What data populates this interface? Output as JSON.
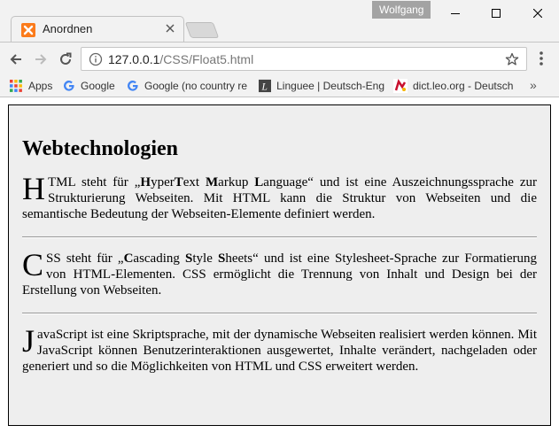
{
  "window": {
    "profile_name": "Wolfgang"
  },
  "tab": {
    "title": "Anordnen"
  },
  "address_bar": {
    "url_host": "127.0.0.1",
    "url_path": "/CSS/Float5.html"
  },
  "bookmarks": [
    {
      "label": "Apps",
      "icon": "apps-grid-icon"
    },
    {
      "label": "Google",
      "icon": "google-icon"
    },
    {
      "label": "Google (no country re",
      "icon": "google-icon"
    },
    {
      "label": "Linguee | Deutsch-Eng",
      "icon": "linguee-icon"
    },
    {
      "label": "dict.leo.org - Deutsch",
      "icon": "leo-icon"
    }
  ],
  "page": {
    "heading": "Webtechnologien",
    "paragraphs": [
      {
        "cap": "H",
        "text_a": "TML steht für „",
        "b1": "H",
        "t1": "yper",
        "b2": "T",
        "t2": "ext ",
        "b3": "M",
        "t3": "arkup ",
        "b4": "L",
        "t4": "anguage",
        "text_b": "“ und ist eine Auszeichnungssprache zur Strukturierung Webseiten. Mit HTML kann die Struktur von Webseiten und die semantische Bedeutung der Webseiten-Elemente definiert werden."
      },
      {
        "cap": "C",
        "text_a": "SS steht für „",
        "b1": "C",
        "t1": "ascading ",
        "b2": "S",
        "t2": "tyle ",
        "b3": "S",
        "t3": "heets",
        "text_b": "“ und ist eine Stylesheet-Sprache zur Formatierung von HTML-Elementen. CSS ermöglicht die Trennung von Inhalt und Design bei der Erstellung von Webseiten."
      },
      {
        "cap": "J",
        "text": "avaScript ist eine Skriptsprache, mit der dynamische Webseiten realisiert werden können. Mit JavaScript können Benutzerinteraktionen ausgewertet, Inhalte verändert, nachgeladen oder generiert und so die Möglichkeiten von HTML und CSS erweitert werden."
      }
    ]
  },
  "colors": {
    "page_background": "#eeeeee",
    "favicon": "#fb7b1b"
  }
}
